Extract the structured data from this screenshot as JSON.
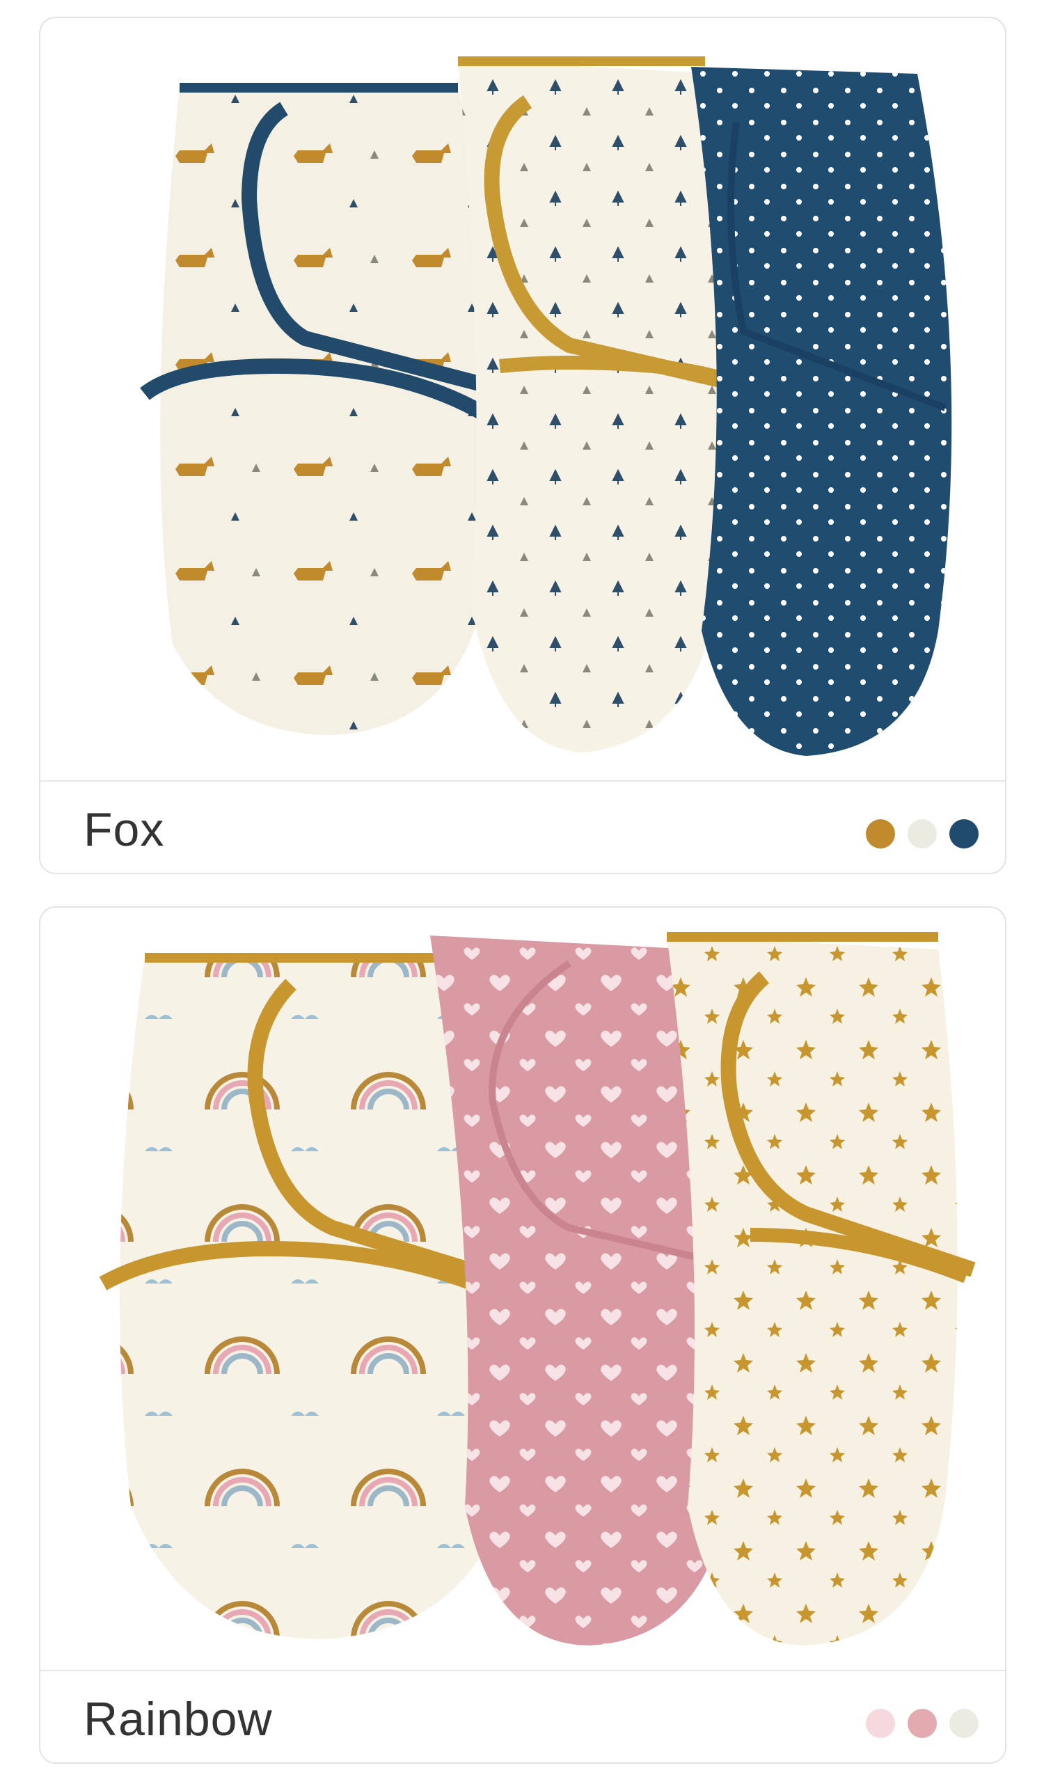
{
  "variants": [
    {
      "name": "Fox",
      "swatches": [
        "#c08a2d",
        "#ecebe1",
        "#1f4a6e"
      ],
      "swatch_names": [
        "mustard",
        "cream",
        "navy"
      ],
      "photo_items": [
        "fox-print-swaddle",
        "tree-print-swaddle",
        "dot-print-swaddle"
      ]
    },
    {
      "name": "Rainbow",
      "swatches": [
        "#f6d9dc",
        "#e3aab0",
        "#ecebe1"
      ],
      "swatch_names": [
        "light-pink",
        "pink",
        "cream"
      ],
      "photo_items": [
        "rainbow-print-swaddle",
        "heart-print-swaddle",
        "star-print-swaddle"
      ]
    }
  ]
}
